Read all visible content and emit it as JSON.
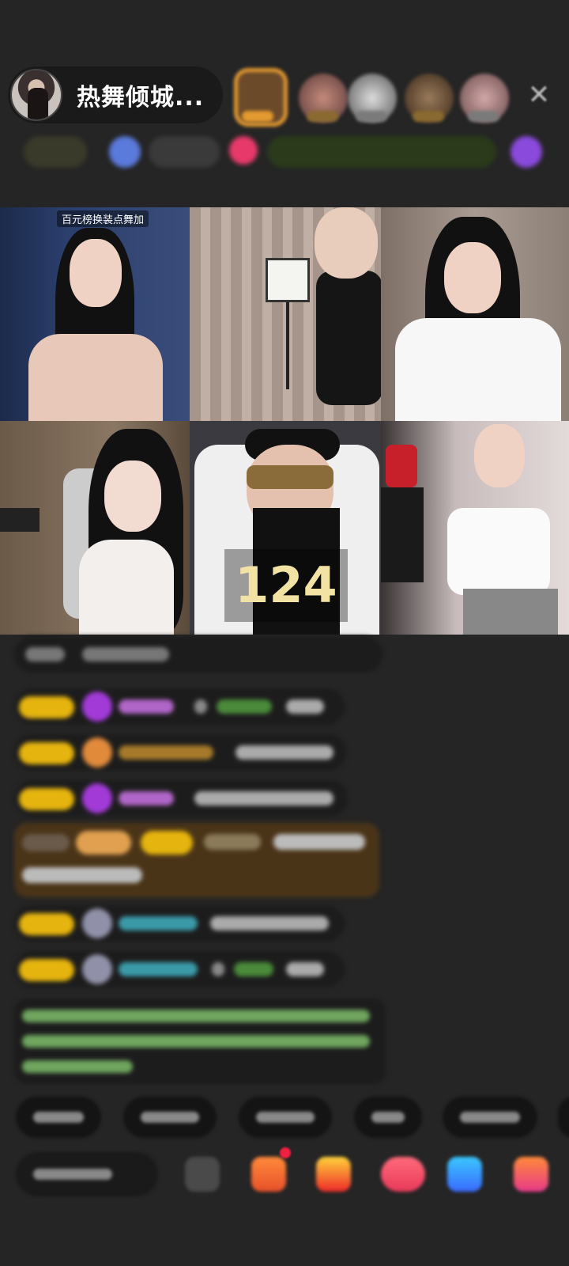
{
  "header": {
    "host_name": "热舞倾城...",
    "close_icon": "close-icon"
  },
  "grid": {
    "tile1_tag": "百元榜换装点舞加",
    "counter": "124"
  },
  "colors": {
    "background": "#252525",
    "level_badge": "#e5b40e",
    "gift_highlight": "#4a3418",
    "system_text": "#6fa55e"
  }
}
